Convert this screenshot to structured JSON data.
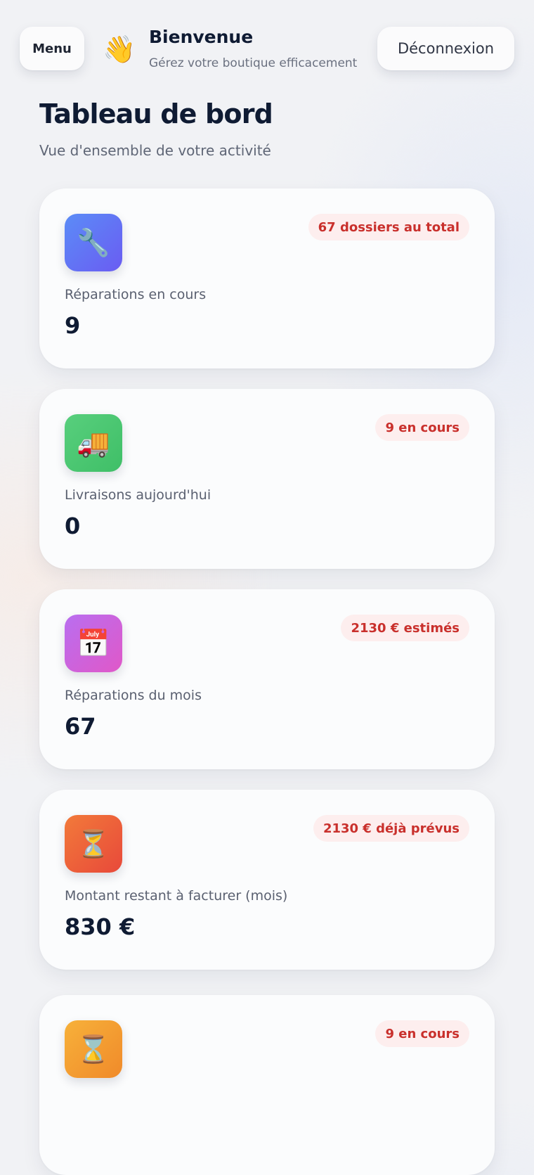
{
  "header": {
    "menu_label": "Menu",
    "wave_emoji": "👋",
    "welcome_title": "Bienvenue",
    "welcome_subtitle": "Gérez votre boutique efficacement",
    "logout_label": "Déconnexion"
  },
  "page": {
    "title": "Tableau de bord",
    "subtitle": "Vue d'ensemble de votre activité"
  },
  "cards": [
    {
      "icon": "wrench-icon",
      "icon_glyph": "🔧",
      "badge": "67 dossiers au total",
      "label": "Réparations en cours",
      "value": "9"
    },
    {
      "icon": "delivery-truck-icon",
      "icon_glyph": "🚚",
      "badge": "9 en cours",
      "label": "Livraisons aujourd'hui",
      "value": "0"
    },
    {
      "icon": "calendar-icon",
      "icon_glyph": "📅",
      "badge": "2130 € estimés",
      "label": "Réparations du mois",
      "value": "67"
    },
    {
      "icon": "hourglass-icon",
      "icon_glyph": "⏳",
      "badge": "2130 € déjà prévus",
      "label": "Montant restant à facturer (mois)",
      "value": "830 €"
    },
    {
      "icon": "hourglass-icon",
      "icon_glyph": "⌛",
      "badge": "9 en cours",
      "label": "",
      "value": ""
    }
  ],
  "colors": {
    "badge_text": "#c9302c",
    "badge_bg": "#fdeeee",
    "title_text": "#0f1b33"
  }
}
